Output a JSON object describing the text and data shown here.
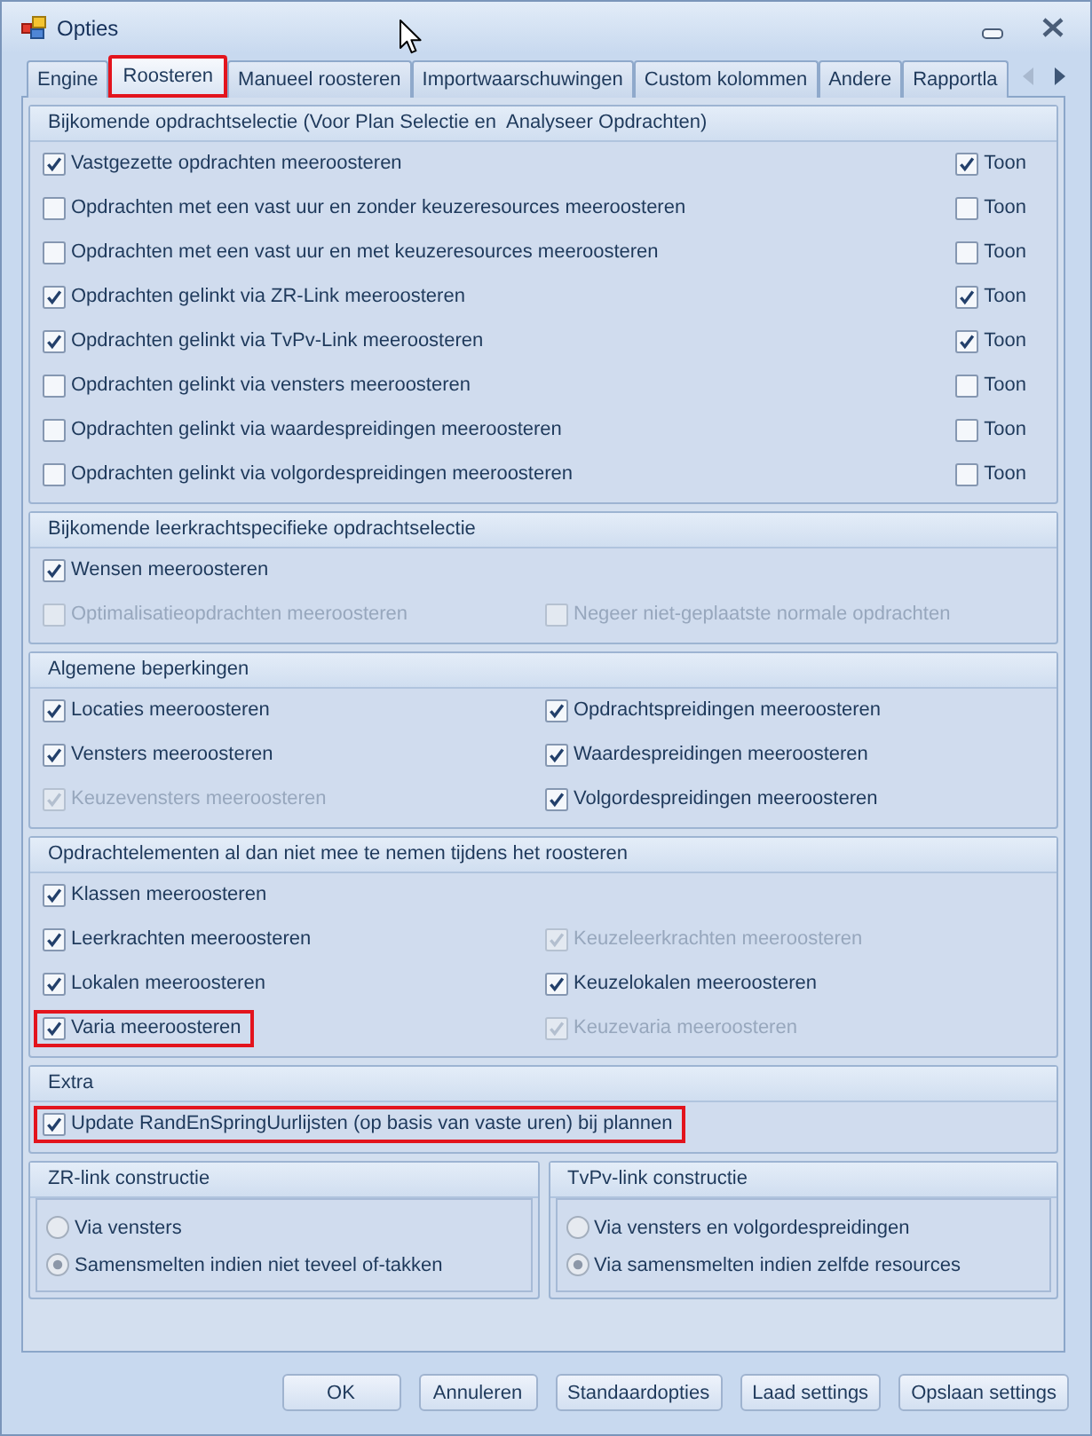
{
  "window": {
    "title": "Opties"
  },
  "tabs": [
    {
      "label": "Engine",
      "selected": false,
      "highlighted": false
    },
    {
      "label": "Roosteren",
      "selected": true,
      "highlighted": true
    },
    {
      "label": "Manueel roosteren",
      "selected": false,
      "highlighted": false
    },
    {
      "label": "Importwaarschuwingen",
      "selected": false,
      "highlighted": false
    },
    {
      "label": "Custom kolommen",
      "selected": false,
      "highlighted": false
    },
    {
      "label": "Andere",
      "selected": false,
      "highlighted": false
    },
    {
      "label": "Rapportla",
      "selected": false,
      "highlighted": false
    }
  ],
  "tab_scroll": {
    "back_disabled": true,
    "forward_disabled": false
  },
  "groups": [
    {
      "title": "Bijkomende opdrachtselectie (Voor Plan Selectie en  Analyseer Opdrachten)",
      "kind": "with_toggle",
      "rows": [
        {
          "option": {
            "label": "Vastgezette opdrachten meeroosteren",
            "checked": true,
            "disabled": false,
            "highlighted": false
          },
          "toggle": {
            "label": "Toon",
            "checked": true
          }
        },
        {
          "option": {
            "label": "Opdrachten met een vast uur en zonder keuzeresources meeroosteren",
            "checked": false,
            "disabled": false,
            "highlighted": false
          },
          "toggle": {
            "label": "Toon",
            "checked": false
          }
        },
        {
          "option": {
            "label": "Opdrachten met een vast uur en met keuzeresources meeroosteren",
            "checked": false,
            "disabled": false,
            "highlighted": false
          },
          "toggle": {
            "label": "Toon",
            "checked": false
          }
        },
        {
          "option": {
            "label": "Opdrachten gelinkt via ZR-Link meeroosteren",
            "checked": true,
            "disabled": false,
            "highlighted": false
          },
          "toggle": {
            "label": "Toon",
            "checked": true
          }
        },
        {
          "option": {
            "label": "Opdrachten gelinkt via TvPv-Link meeroosteren",
            "checked": true,
            "disabled": false,
            "highlighted": false
          },
          "toggle": {
            "label": "Toon",
            "checked": true
          }
        },
        {
          "option": {
            "label": "Opdrachten gelinkt via vensters meeroosteren",
            "checked": false,
            "disabled": false,
            "highlighted": false
          },
          "toggle": {
            "label": "Toon",
            "checked": false
          }
        },
        {
          "option": {
            "label": "Opdrachten gelinkt via waardespreidingen meeroosteren",
            "checked": false,
            "disabled": false,
            "highlighted": false
          },
          "toggle": {
            "label": "Toon",
            "checked": false
          }
        },
        {
          "option": {
            "label": "Opdrachten gelinkt via volgordespreidingen meeroosteren",
            "checked": false,
            "disabled": false,
            "highlighted": false
          },
          "toggle": {
            "label": "Toon",
            "checked": false
          }
        }
      ]
    },
    {
      "title": "Bijkomende leerkrachtspecifieke opdrachtselectie",
      "kind": "grid",
      "rows": [
        [
          {
            "label": "Wensen meeroosteren",
            "checked": true,
            "disabled": false,
            "highlighted": false
          }
        ],
        [
          {
            "label": "Optimalisatieopdrachten meeroosteren",
            "checked": false,
            "disabled": true,
            "highlighted": false
          },
          {
            "label": "Negeer niet-geplaatste normale opdrachten",
            "checked": false,
            "disabled": true,
            "highlighted": false
          }
        ]
      ]
    },
    {
      "title": "Algemene beperkingen",
      "kind": "grid",
      "rows": [
        [
          {
            "label": "Locaties meeroosteren",
            "checked": true,
            "disabled": false,
            "highlighted": false
          },
          {
            "label": "Opdrachtspreidingen meeroosteren",
            "checked": true,
            "disabled": false,
            "highlighted": false
          }
        ],
        [
          {
            "label": "Vensters meeroosteren",
            "checked": true,
            "disabled": false,
            "highlighted": false
          },
          {
            "label": "Waardespreidingen meeroosteren",
            "checked": true,
            "disabled": false,
            "highlighted": false
          }
        ],
        [
          {
            "label": "Keuzevensters meeroosteren",
            "checked": true,
            "disabled": true,
            "highlighted": false
          },
          {
            "label": "Volgordespreidingen meeroosteren",
            "checked": true,
            "disabled": false,
            "highlighted": false
          }
        ]
      ]
    },
    {
      "title": "Opdrachtelementen al dan niet mee te nemen tijdens het roosteren",
      "kind": "grid",
      "rows": [
        [
          {
            "label": "Klassen meeroosteren",
            "checked": true,
            "disabled": false,
            "highlighted": false
          }
        ],
        [
          {
            "label": "Leerkrachten meeroosteren",
            "checked": true,
            "disabled": false,
            "highlighted": false
          },
          {
            "label": "Keuzeleerkrachten meeroosteren",
            "checked": true,
            "disabled": true,
            "highlighted": false
          }
        ],
        [
          {
            "label": "Lokalen meeroosteren",
            "checked": true,
            "disabled": false,
            "highlighted": false
          },
          {
            "label": "Keuzelokalen meeroosteren",
            "checked": true,
            "disabled": false,
            "highlighted": false
          }
        ],
        [
          {
            "label": "Varia meeroosteren",
            "checked": true,
            "disabled": false,
            "highlighted": true
          },
          {
            "label": "Keuzevaria meeroosteren",
            "checked": true,
            "disabled": true,
            "highlighted": false
          }
        ]
      ]
    },
    {
      "title": "Extra",
      "kind": "grid",
      "rows": [
        [
          {
            "label": "Update RandEnSpringUurlijsten (op basis van vaste uren) bij plannen",
            "checked": true,
            "disabled": false,
            "highlighted": true
          }
        ]
      ]
    }
  ],
  "radio_groups": [
    {
      "title": "ZR-link constructie",
      "options": [
        {
          "label": "Via vensters",
          "selected": false
        },
        {
          "label": "Samensmelten indien niet teveel of-takken",
          "selected": true
        }
      ]
    },
    {
      "title": "TvPv-link constructie",
      "options": [
        {
          "label": "Via vensters en volgordespreidingen",
          "selected": false
        },
        {
          "label": "Via samensmelten indien zelfde resources",
          "selected": true
        }
      ]
    }
  ],
  "buttons": [
    "OK",
    "Annuleren",
    "Standaardopties",
    "Laad settings",
    "Opslaan settings"
  ]
}
